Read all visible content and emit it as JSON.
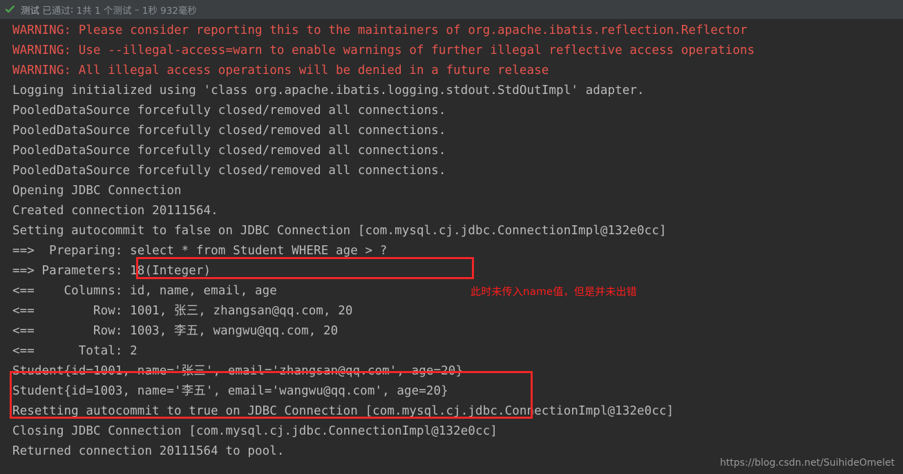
{
  "status_bar": {
    "icon": "green-check-icon",
    "accent_color": "#4ca64c",
    "background": "#3c3f41",
    "label": "测试",
    "result": "已通过",
    "separator": ": ",
    "counts": "1共 1 个测试",
    "dash": " – ",
    "duration": "1秒 932毫秒"
  },
  "console": {
    "background": "#2b2b2b",
    "text_color": "#bbbbbb",
    "warning_color": "#e8564e",
    "lines": [
      {
        "text": "WARNING: Please consider reporting this to the maintainers of org.apache.ibatis.reflection.Reflector",
        "type": "warning"
      },
      {
        "text": "WARNING: Use --illegal-access=warn to enable warnings of further illegal reflective access operations",
        "type": "warning"
      },
      {
        "text": "WARNING: All illegal access operations will be denied in a future release",
        "type": "warning"
      },
      {
        "text": "Logging initialized using 'class org.apache.ibatis.logging.stdout.StdOutImpl' adapter.",
        "type": "normal"
      },
      {
        "text": "PooledDataSource forcefully closed/removed all connections.",
        "type": "normal"
      },
      {
        "text": "PooledDataSource forcefully closed/removed all connections.",
        "type": "normal"
      },
      {
        "text": "PooledDataSource forcefully closed/removed all connections.",
        "type": "normal"
      },
      {
        "text": "PooledDataSource forcefully closed/removed all connections.",
        "type": "normal"
      },
      {
        "text": "Opening JDBC Connection",
        "type": "normal"
      },
      {
        "text": "Created connection 20111564.",
        "type": "normal"
      },
      {
        "text": "Setting autocommit to false on JDBC Connection [com.mysql.cj.jdbc.ConnectionImpl@132e0cc]",
        "type": "normal"
      },
      {
        "text": "==>  Preparing: select * from Student WHERE age > ?",
        "type": "normal"
      },
      {
        "text": "==> Parameters: 18(Integer)",
        "type": "normal"
      },
      {
        "text": "<==    Columns: id, name, email, age",
        "type": "normal"
      },
      {
        "text": "<==        Row: 1001, 张三, zhangsan@qq.com, 20",
        "type": "normal"
      },
      {
        "text": "<==        Row: 1003, 李五, wangwu@qq.com, 20",
        "type": "normal"
      },
      {
        "text": "<==      Total: 2",
        "type": "normal"
      },
      {
        "text": "Student{id=1001, name='张三', email='zhangsan@qq.com', age=20}",
        "type": "normal"
      },
      {
        "text": "Student{id=1003, name='李五', email='wangwu@qq.com', age=20}",
        "type": "normal"
      },
      {
        "text": "Resetting autocommit to true on JDBC Connection [com.mysql.cj.jdbc.ConnectionImpl@132e0cc]",
        "type": "normal"
      },
      {
        "text": "Closing JDBC Connection [com.mysql.cj.jdbc.ConnectionImpl@132e0cc]",
        "type": "normal"
      },
      {
        "text": "Returned connection 20111564 to pool.",
        "type": "normal"
      }
    ]
  },
  "annotations": {
    "box_color": "#f32626",
    "note_color": "#ff1d1d",
    "sql_box_target": "select * from Student WHERE age > ?",
    "result_box_target": "Student result rows",
    "note_text": "此时未传入name值，但是并未出错"
  },
  "watermark": {
    "text": "https://blog.csdn.net/SuihideOmelet"
  }
}
